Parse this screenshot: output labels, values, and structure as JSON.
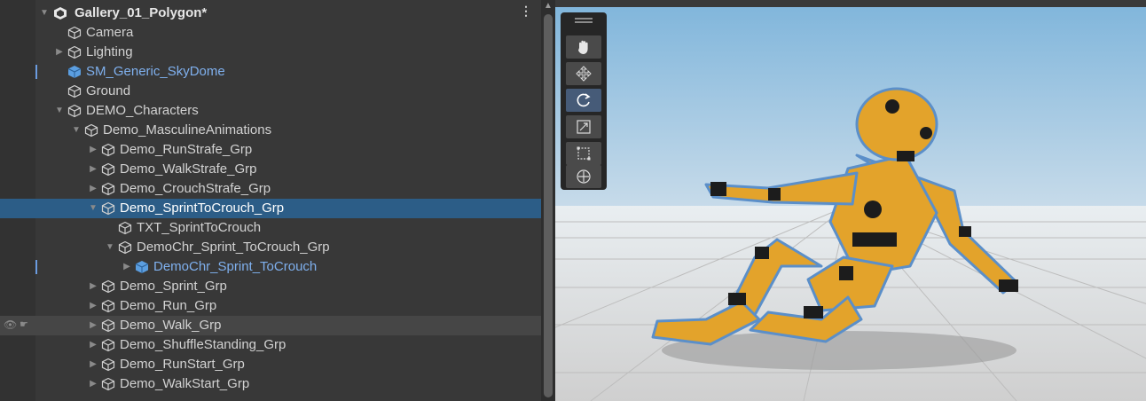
{
  "hierarchy": {
    "scene_name": "Gallery_01_Polygon*",
    "menu_icon": "kebab-menu-icon",
    "items": [
      {
        "label": "Camera",
        "icon": "gameobject-icon"
      },
      {
        "label": "Lighting",
        "icon": "gameobject-icon",
        "expandable": true
      },
      {
        "label": "SM_Generic_SkyDome",
        "icon": "prefab-icon",
        "style": "prefab"
      },
      {
        "label": "Ground",
        "icon": "gameobject-icon"
      },
      {
        "label": "DEMO_Characters",
        "icon": "gameobject-icon",
        "expanded": true
      },
      {
        "label": "Demo_MasculineAnimations",
        "icon": "gameobject-icon",
        "expanded": true
      },
      {
        "label": "Demo_RunStrafe_Grp",
        "icon": "gameobject-icon",
        "expandable": true
      },
      {
        "label": "Demo_WalkStrafe_Grp",
        "icon": "gameobject-icon",
        "expandable": true
      },
      {
        "label": "Demo_CrouchStrafe_Grp",
        "icon": "gameobject-icon",
        "expandable": true
      },
      {
        "label": "Demo_SprintToCrouch_Grp",
        "icon": "gameobject-icon",
        "expanded": true,
        "selected": true
      },
      {
        "label": "TXT_SprintToCrouch",
        "icon": "gameobject-icon"
      },
      {
        "label": "DemoChr_Sprint_ToCrouch_Grp",
        "icon": "gameobject-icon",
        "expanded": true
      },
      {
        "label": "DemoChr_Sprint_ToCrouch",
        "icon": "prefab-icon",
        "style": "prefab",
        "expandable": true
      },
      {
        "label": "Demo_Sprint_Grp",
        "icon": "gameobject-icon",
        "expandable": true
      },
      {
        "label": "Demo_Run_Grp",
        "icon": "gameobject-icon",
        "expandable": true
      },
      {
        "label": "Demo_Walk_Grp",
        "icon": "gameobject-icon",
        "expandable": true,
        "hovered": true
      },
      {
        "label": "Demo_ShuffleStanding_Grp",
        "icon": "gameobject-icon",
        "expandable": true
      },
      {
        "label": "Demo_RunStart_Grp",
        "icon": "gameobject-icon",
        "expandable": true
      },
      {
        "label": "Demo_WalkStart_Grp",
        "icon": "gameobject-icon",
        "expandable": true
      }
    ]
  },
  "scene_view": {
    "tools": [
      {
        "name": "hand-tool",
        "icon": "hand-icon",
        "active": false
      },
      {
        "name": "move-tool",
        "icon": "move-arrows-icon",
        "active": false
      },
      {
        "name": "rotate-tool",
        "icon": "rotate-icon",
        "active": true
      },
      {
        "name": "scale-tool",
        "icon": "scale-icon",
        "active": false
      },
      {
        "name": "rect-tool",
        "icon": "rect-icon",
        "active": false
      },
      {
        "name": "transform-tool",
        "icon": "transform-icon",
        "active": false
      }
    ],
    "colors": {
      "sky_top": "#7fb5db",
      "sky_bottom": "#c9dcea",
      "floor": "#dcdcdc",
      "character": "#e3a32b",
      "character_dark": "#b06f12",
      "joints": "#1c1c1c",
      "selection_outline": "#5b8fc9"
    }
  }
}
